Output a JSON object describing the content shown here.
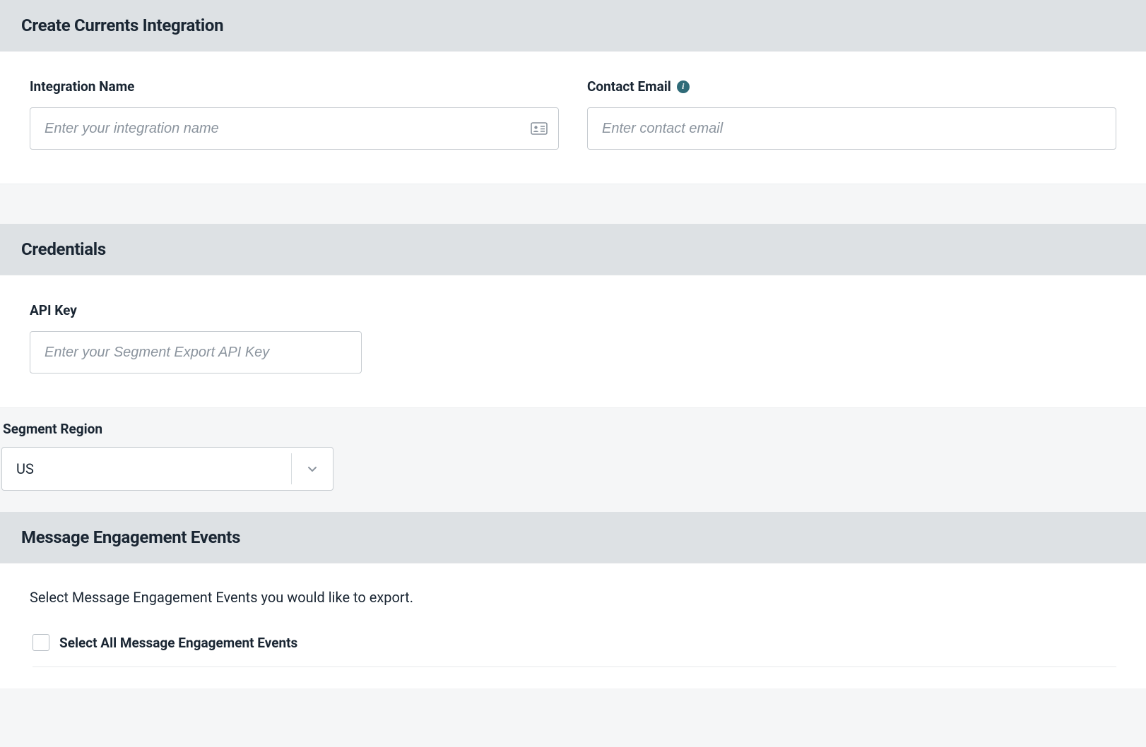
{
  "sections": {
    "create": {
      "title": "Create Currents Integration",
      "integration_name": {
        "label": "Integration Name",
        "placeholder": "Enter your integration name",
        "value": ""
      },
      "contact_email": {
        "label": "Contact Email",
        "placeholder": "Enter contact email",
        "value": ""
      }
    },
    "credentials": {
      "title": "Credentials",
      "api_key": {
        "label": "API Key",
        "placeholder": "Enter your Segment Export API Key",
        "value": ""
      }
    },
    "segment_region": {
      "label": "Segment Region",
      "selected": "US"
    },
    "events": {
      "title": "Message Engagement Events",
      "instruction": "Select Message Engagement Events you would like to export.",
      "select_all_label": "Select All Message Engagement Events",
      "select_all_checked": false
    }
  },
  "icons": {
    "info": "info-icon",
    "id_card": "id-card-icon",
    "chevron_down": "chevron-down-icon"
  }
}
